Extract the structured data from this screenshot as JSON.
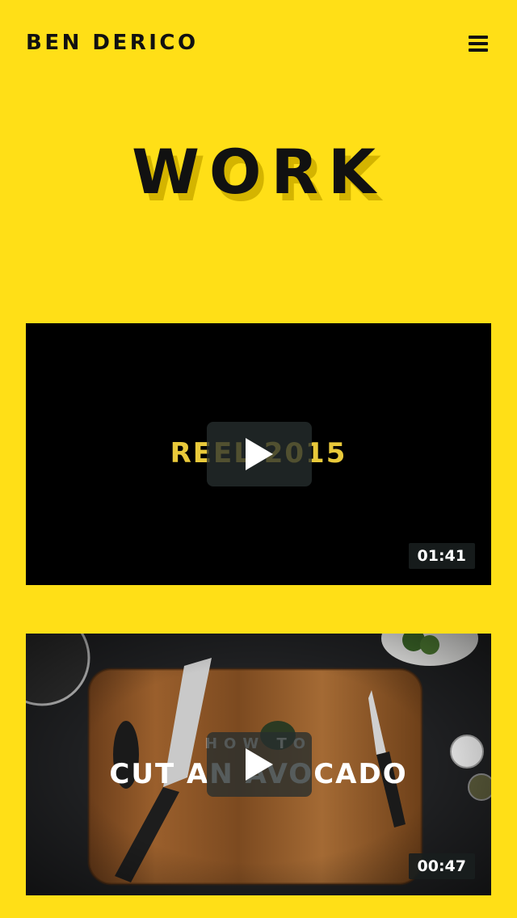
{
  "header": {
    "brand": "BEN DERICO",
    "menu_icon": "hamburger-menu-icon"
  },
  "page": {
    "title": "WORK"
  },
  "videos": [
    {
      "title": "REEL 2015",
      "duration": "01:41",
      "play_icon": "play-icon"
    },
    {
      "subtitle": "HOW TO",
      "title": "CUT AN AVOCADO",
      "duration": "00:47",
      "play_icon": "play-icon"
    }
  ],
  "colors": {
    "background": "#FFDF17",
    "title_shadow": "#D4B400",
    "reel_text": "#E9C93A",
    "text": "#111111"
  }
}
